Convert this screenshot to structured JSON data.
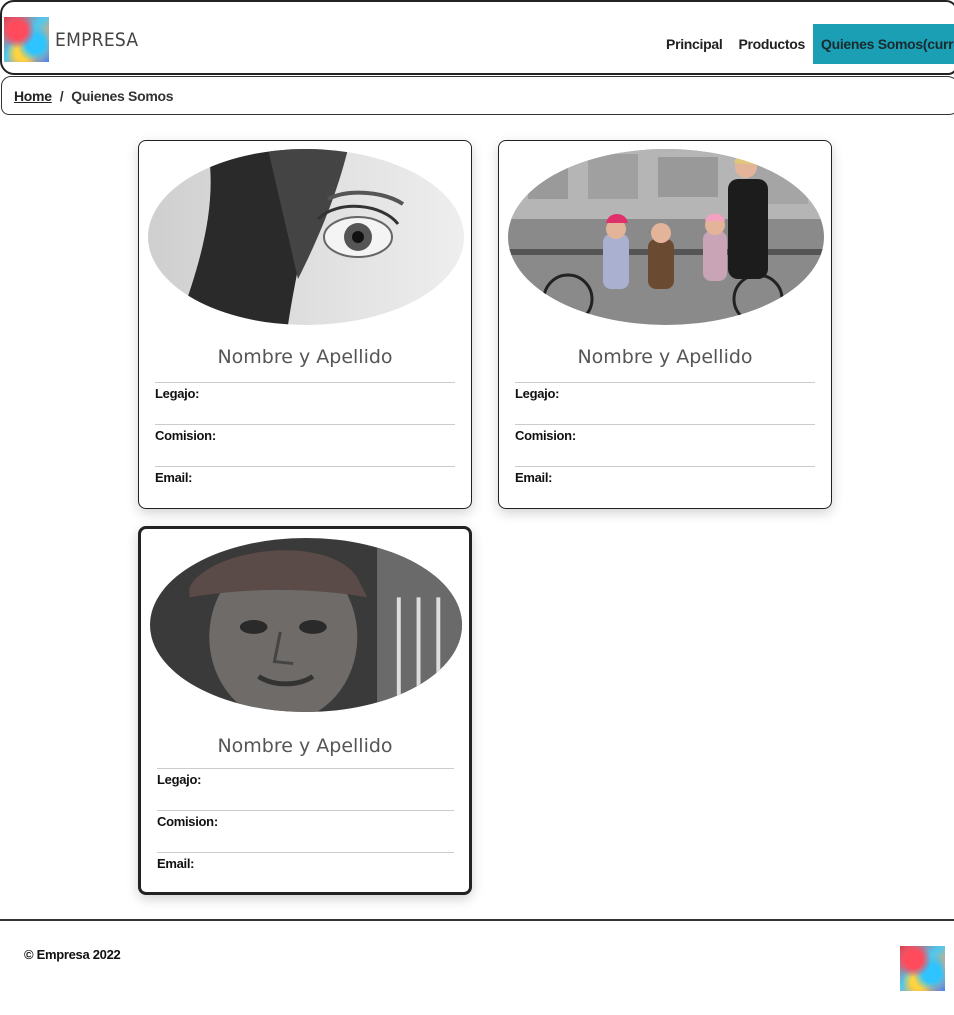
{
  "header": {
    "brand": "EMPRESA",
    "logo_icon": "abstract-painting-logo",
    "nav": [
      {
        "label": "Principal",
        "active": false
      },
      {
        "label": "Productos",
        "active": false
      },
      {
        "label": "Quienes Somos(current)",
        "active": true
      }
    ],
    "accent_color": "#1a9fb4"
  },
  "breadcrumb": {
    "home": "Home",
    "separator": "/",
    "current": "Quienes Somos"
  },
  "cards": [
    {
      "photo": "woman-eye-bw-photo",
      "name": "Nombre y Apellido",
      "legajo": "Legajo:",
      "comision": "Comision:",
      "email": "Email:"
    },
    {
      "photo": "family-bicycle-photo",
      "name": "Nombre y Apellido",
      "legajo": "Legajo:",
      "comision": "Comision:",
      "email": "Email:"
    },
    {
      "photo": "old-man-cap-photo",
      "name": "Nombre y Apellido",
      "legajo": "Legajo:",
      "comision": "Comision:",
      "email": "Email:"
    }
  ],
  "footer": {
    "copyright": "© Empresa 2022",
    "logo_icon": "abstract-painting-logo"
  }
}
